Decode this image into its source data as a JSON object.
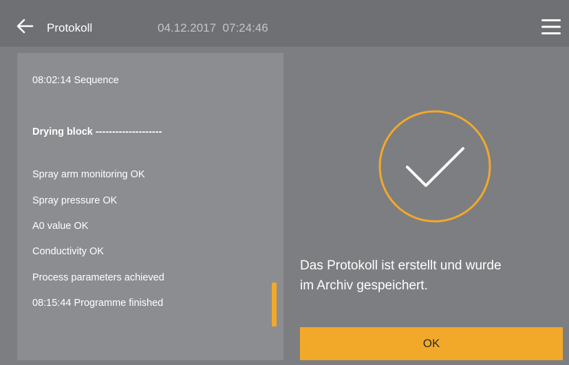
{
  "header": {
    "title": "Protokoll",
    "date": "04.12.2017",
    "time": "07:24:46",
    "back_icon": "arrow-left-icon",
    "menu_icon": "hamburger-menu-icon"
  },
  "log": {
    "lines": [
      "08:02:14 Sequence",
      "Drying block --------------------",
      "Spray arm monitoring OK",
      "Spray pressure OK",
      "A0 value OK",
      "Conductivity OK",
      "Process parameters achieved",
      "08:15:44 Programme finished"
    ]
  },
  "status": {
    "icon": "checkmark-circle-icon",
    "message_line1": "Das Protokoll ist erstellt und wurde",
    "message_line2": "im Archiv gespeichert."
  },
  "ok_label": "OK",
  "colors": {
    "accent": "#f2a92a",
    "header_bg": "#6f7073",
    "panel_bg": "#8c8d90",
    "background": "#7d7e81"
  }
}
